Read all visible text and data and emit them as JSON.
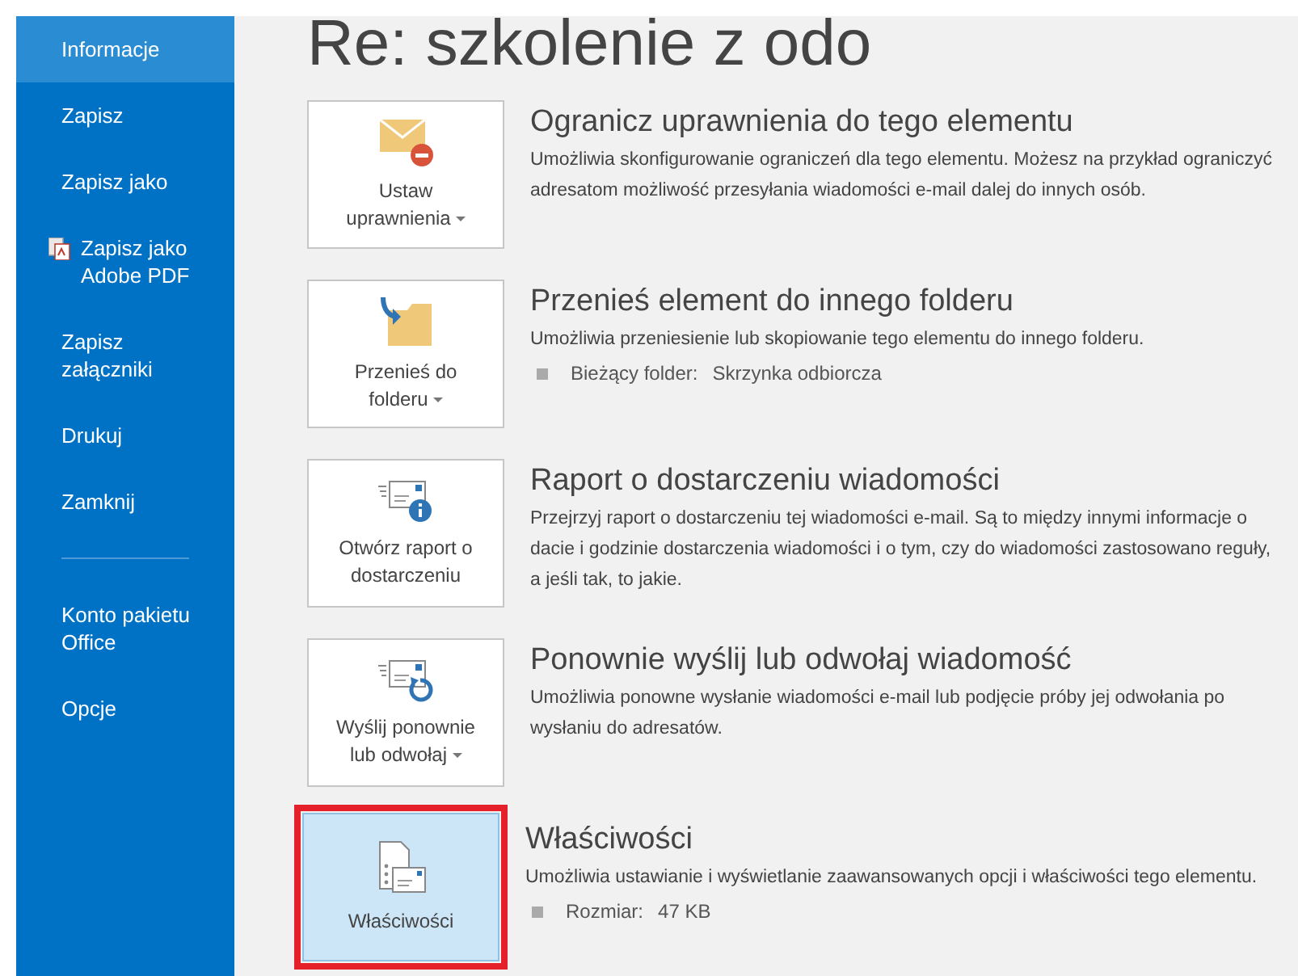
{
  "sidebar": {
    "items": [
      {
        "label": "Informacje",
        "selected": true,
        "kind": "plain"
      },
      {
        "label": "Zapisz",
        "selected": false,
        "kind": "plain"
      },
      {
        "label": "Zapisz jako",
        "selected": false,
        "kind": "plain"
      },
      {
        "label": "Zapisz jako Adobe PDF",
        "selected": false,
        "kind": "pdf"
      },
      {
        "label": "Zapisz załączniki",
        "selected": false,
        "kind": "plain"
      },
      {
        "label": "Drukuj",
        "selected": false,
        "kind": "plain"
      },
      {
        "label": "Zamknij",
        "selected": false,
        "kind": "plain"
      },
      {
        "label": "Konto pakietu Office",
        "selected": false,
        "kind": "separated"
      },
      {
        "label": "Opcje",
        "selected": false,
        "kind": "plain"
      }
    ]
  },
  "title": "Re: szkolenie z odo",
  "sections": [
    {
      "kind": "restrict",
      "button": "Ustaw uprawnienia",
      "has_menu": true,
      "selected": false,
      "highlighted": false,
      "heading": "Ogranicz uprawnienia do tego elementu",
      "description": "Umożliwia skonfigurowanie ograniczeń dla tego elementu. Możesz na przykład ograniczyć adresatom możliwość przesyłania wiadomości e-mail dalej do innych osób."
    },
    {
      "kind": "move",
      "button": "Przenieś do folderu",
      "has_menu": true,
      "selected": false,
      "highlighted": false,
      "heading": "Przenieś element do innego folderu",
      "description": "Umożliwia przeniesienie lub skopiowanie tego elementu do innego folderu.",
      "detail": {
        "label": "Bieżący folder:",
        "value": "Skrzynka odbiorcza"
      }
    },
    {
      "kind": "report",
      "button": "Otwórz raport o dostarczeniu",
      "has_menu": false,
      "selected": false,
      "highlighted": false,
      "heading": "Raport o dostarczeniu wiadomości",
      "description": "Przejrzyj raport o dostarczeniu tej wiadomości e-mail. Są to między innymi informacje o dacie i godzinie dostarczenia wiadomości i o tym, czy do wiadomości zastosowano reguły, a jeśli tak, to jakie."
    },
    {
      "kind": "resend",
      "button": "Wyślij ponownie lub odwołaj",
      "has_menu": true,
      "selected": false,
      "highlighted": false,
      "heading": "Ponownie wyślij lub odwołaj wiadomość",
      "description": "Umożliwia ponowne wysłanie wiadomości e-mail lub podjęcie próby jej odwołania po wysłaniu do adresatów."
    },
    {
      "kind": "properties",
      "button": "Właściwości",
      "has_menu": false,
      "selected": true,
      "highlighted": true,
      "heading": "Właściwości",
      "description": "Umożliwia ustawianie i wyświetlanie zaawansowanych opcji i właściwości tego elementu.",
      "detail": {
        "label": "Rozmiar:",
        "value": "47 KB"
      }
    }
  ]
}
